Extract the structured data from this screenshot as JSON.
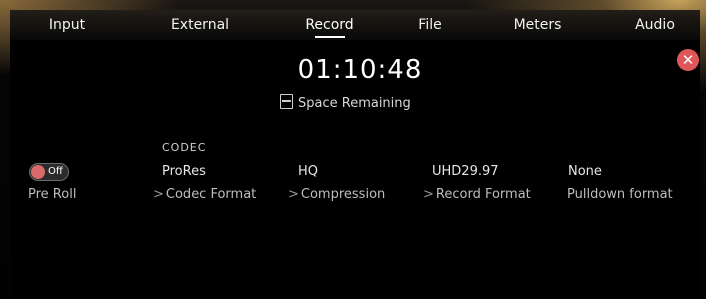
{
  "tabs": [
    {
      "label": "Input",
      "active": false
    },
    {
      "label": "External",
      "active": false
    },
    {
      "label": "Record",
      "active": true
    },
    {
      "label": "File",
      "active": false
    },
    {
      "label": "Meters",
      "active": false
    },
    {
      "label": "Audio",
      "active": false
    }
  ],
  "close_icon": "close-icon",
  "timecode": "01:10:48",
  "space": {
    "icon": "ssd-icon",
    "label": "Space Remaining"
  },
  "codec_header": "CODEC",
  "settings": {
    "pre_roll": {
      "toggle_text": "Off",
      "label": "Pre Roll"
    },
    "codec_format": {
      "value": "ProRes",
      "label": "Codec Format"
    },
    "compression": {
      "value": "HQ",
      "label": "Compression"
    },
    "record_format": {
      "value": "UHD29.97",
      "label": "Record Format"
    },
    "pulldown_format": {
      "value": "None",
      "label": "Pulldown format"
    }
  },
  "chevron": ">",
  "colors": {
    "accent_red": "#e0575a",
    "background": "#000000"
  }
}
